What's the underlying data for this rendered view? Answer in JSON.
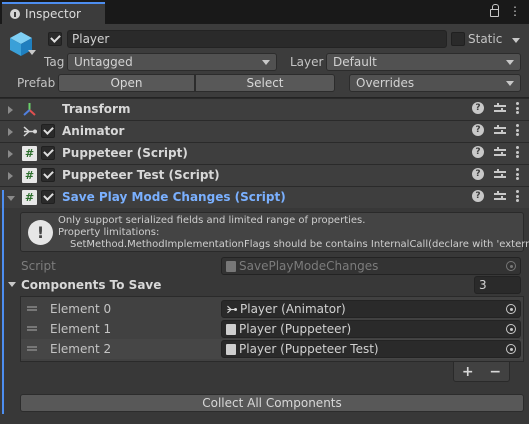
{
  "window": {
    "tab_title": "Inspector",
    "menu_glyph": "⋮"
  },
  "header": {
    "object_name": "Player",
    "static_label": "Static",
    "tag_label": "Tag",
    "tag_value": "Untagged",
    "layer_label": "Layer",
    "layer_value": "Default",
    "prefab_label": "Prefab",
    "open_label": "Open",
    "select_label": "Select",
    "overrides_label": "Overrides"
  },
  "components": [
    {
      "name": "Transform",
      "icon": "transform-icon",
      "has_checkbox": false
    },
    {
      "name": "Animator",
      "icon": "animator-icon",
      "has_checkbox": true
    },
    {
      "name": "Puppeteer (Script)",
      "icon": "script-icon",
      "has_checkbox": true
    },
    {
      "name": "Puppeteer Test (Script)",
      "icon": "script-icon",
      "has_checkbox": true
    },
    {
      "name": "Save Play Mode Changes (Script)",
      "icon": "script-icon",
      "has_checkbox": true
    }
  ],
  "help_box": {
    "line1": "Only support serialized fields and limited range of properties.",
    "line2": "Property limitations:",
    "line3": "SetMethod.MethodImplementationFlags should be contains InternalCall(declare with 'extern')."
  },
  "script_field": {
    "label": "Script",
    "value": "SavePlayModeChanges"
  },
  "list": {
    "label": "Components To Save",
    "size": "3",
    "items": [
      {
        "label": "Element 0",
        "value": "Player (Animator)",
        "icon": "animator-icon"
      },
      {
        "label": "Element 1",
        "value": "Player (Puppeteer)",
        "icon": "script-icon"
      },
      {
        "label": "Element 2",
        "value": "Player (Puppeteer Test)",
        "icon": "script-icon"
      }
    ],
    "add_glyph": "+",
    "remove_glyph": "−"
  },
  "collect_button": "Collect All Components",
  "colors": {
    "accent": "#4d8ef0",
    "highlight_text": "#7ab0ff"
  }
}
